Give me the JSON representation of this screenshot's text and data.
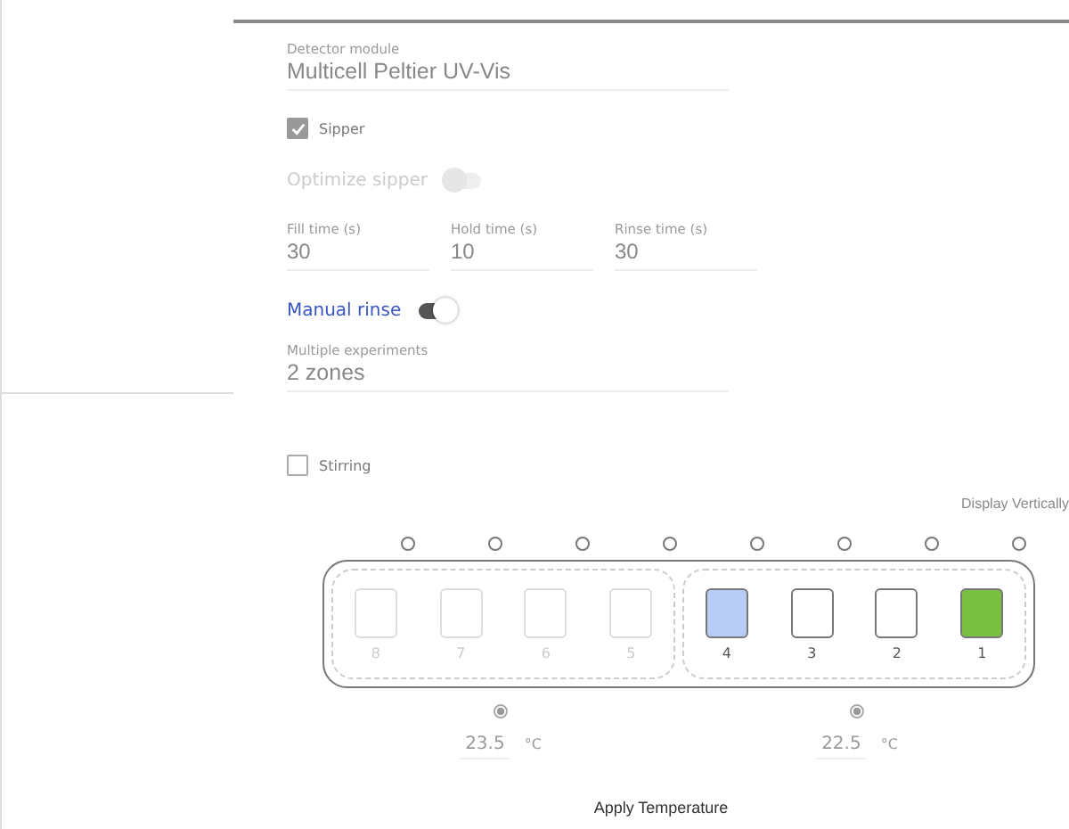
{
  "detector": {
    "label": "Detector module",
    "value": "Multicell Peltier UV-Vis"
  },
  "sipper": {
    "label": "Sipper",
    "checked": true
  },
  "optimize_sipper": {
    "label": "Optimize sipper",
    "on": false,
    "disabled": true
  },
  "times": [
    {
      "label": "Fill time (s)",
      "value": "30"
    },
    {
      "label": "Hold time (s)",
      "value": "10"
    },
    {
      "label": "Rinse time (s)",
      "value": "30"
    }
  ],
  "manual_rinse": {
    "label": "Manual rinse",
    "on": true,
    "disabled": false
  },
  "experiments": {
    "label": "Multiple experiments",
    "value": "2 zones"
  },
  "stirring": {
    "label": "Stirring",
    "checked": false
  },
  "display_link": "Display Vertically",
  "zones": [
    {
      "selected": true,
      "temperature": "23.5",
      "unit": "°C",
      "cells": [
        {
          "label": "8",
          "disabled": true,
          "selected": false,
          "color": "#ffffff"
        },
        {
          "label": "7",
          "disabled": true,
          "selected": false,
          "color": "#ffffff"
        },
        {
          "label": "6",
          "disabled": true,
          "selected": false,
          "color": "#ffffff"
        },
        {
          "label": "5",
          "disabled": true,
          "selected": false,
          "color": "#ffffff"
        }
      ]
    },
    {
      "selected": true,
      "temperature": "22.5",
      "unit": "°C",
      "cells": [
        {
          "label": "4",
          "disabled": false,
          "selected": false,
          "color": "#b7cdf5"
        },
        {
          "label": "3",
          "disabled": false,
          "selected": false,
          "color": "#ffffff"
        },
        {
          "label": "2",
          "disabled": false,
          "selected": false,
          "color": "#ffffff"
        },
        {
          "label": "1",
          "disabled": false,
          "selected": false,
          "color": "#7ac143"
        }
      ]
    }
  ],
  "apply_button": "Apply Temperature"
}
